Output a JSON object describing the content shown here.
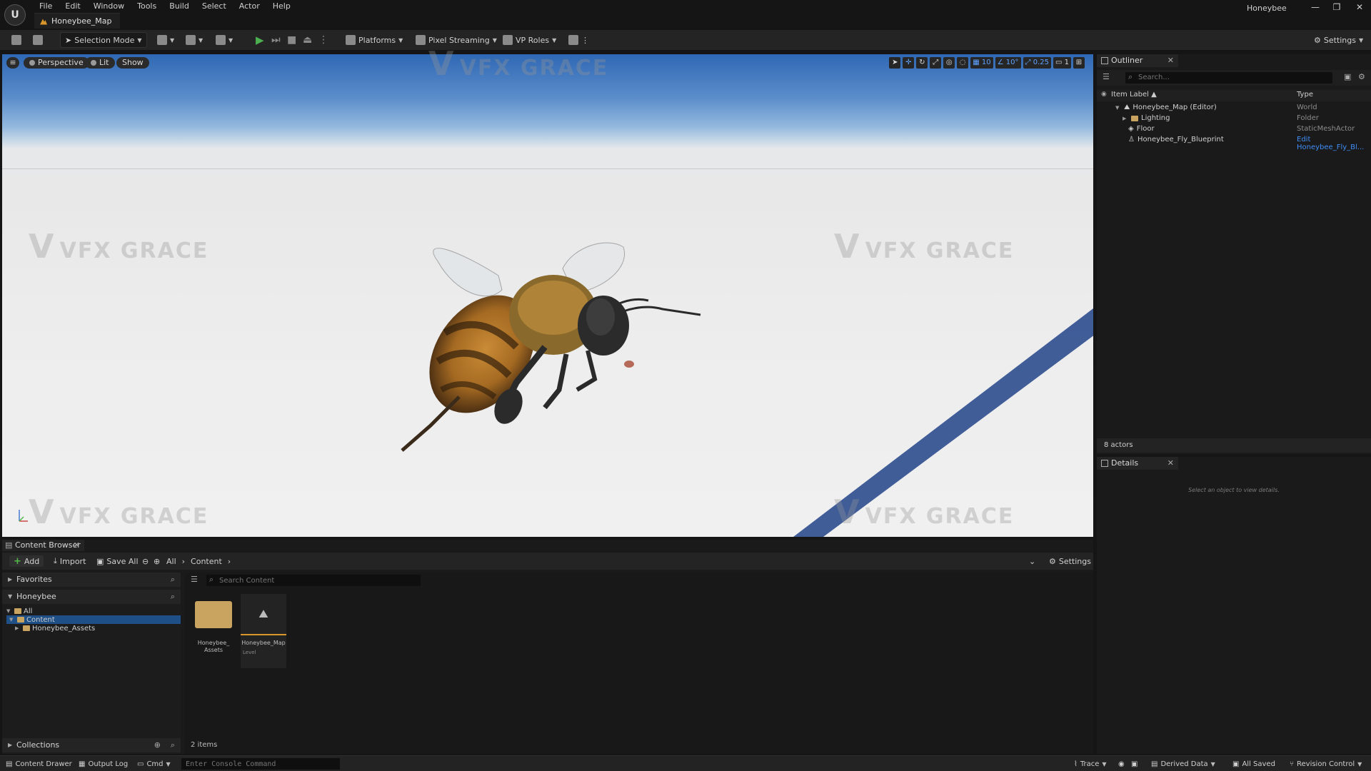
{
  "app": {
    "menus": [
      "File",
      "Edit",
      "Window",
      "Tools",
      "Build",
      "Select",
      "Actor",
      "Help"
    ],
    "level_tab": "Honeybee_Map",
    "project_name": "Honeybee",
    "window_controls": [
      "—",
      "❐",
      "✕"
    ]
  },
  "toolbar": {
    "selection_mode": "Selection Mode",
    "platforms": "Platforms",
    "pixel_streaming": "Pixel Streaming",
    "vp_roles": "VP Roles",
    "settings": "Settings"
  },
  "viewport": {
    "perspective": "Perspective",
    "lit": "Lit",
    "show": "Show",
    "grid_snap": "10",
    "rotation_snap": "10°",
    "scale_snap": "0.25",
    "camera_speed": "1"
  },
  "watermark": "VFX GRACE",
  "outliner": {
    "tab": "Outliner",
    "search_placeholder": "Search...",
    "col_label": "Item Label ▲",
    "col_type": "Type",
    "rows": [
      {
        "label": "Honeybee_Map (Editor)",
        "type": "World"
      },
      {
        "label": "Lighting",
        "type": "Folder"
      },
      {
        "label": "Floor",
        "type": "StaticMeshActor"
      },
      {
        "label": "Honeybee_Fly_Blueprint",
        "type": "Edit Honeybee_Fly_Bl..."
      }
    ],
    "footer": "8 actors"
  },
  "details": {
    "tab": "Details",
    "empty_text": "Select an object to view details."
  },
  "content_browser": {
    "tab": "Content Browser",
    "add": "Add",
    "import": "Import",
    "save_all": "Save All",
    "path": [
      "All",
      "Content"
    ],
    "settings": "Settings",
    "favorites": "Favorites",
    "project": "Honeybee",
    "tree": [
      "All",
      "Content",
      "Honeybee_Assets"
    ],
    "collections": "Collections",
    "search_placeholder": "Search Content",
    "assets": [
      {
        "name": "Honeybee_ Assets",
        "kind": ""
      },
      {
        "name": "Honeybee_Map",
        "kind": "Level"
      }
    ],
    "items_count": "2 items"
  },
  "statusbar": {
    "content_drawer": "Content Drawer",
    "output_log": "Output Log",
    "cmd": "Cmd",
    "console_placeholder": "Enter Console Command",
    "trace": "Trace",
    "derived_data": "Derived Data",
    "all_saved": "All Saved",
    "revision_control": "Revision Control"
  }
}
